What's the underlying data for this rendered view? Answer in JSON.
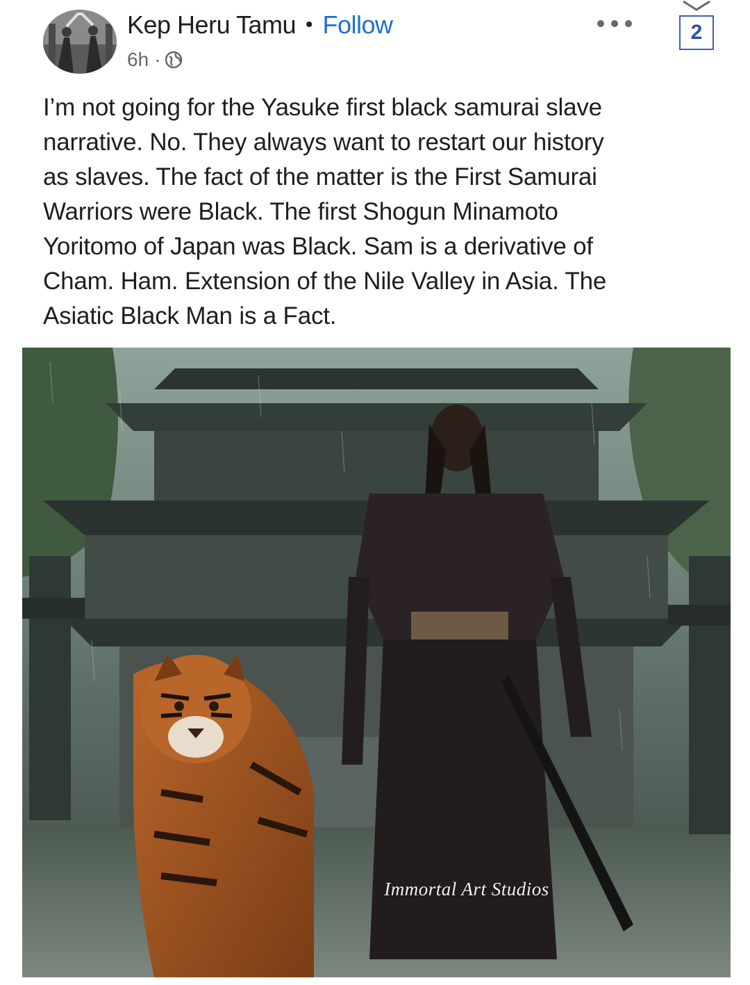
{
  "post": {
    "author": "Kep Heru Tamu",
    "separator": "•",
    "follow_label": "Follow",
    "time": "6h",
    "meta_separator": "·",
    "audience_icon": "globe-icon",
    "more_icon": "more-options-icon",
    "page_number": "2",
    "text": "I’m not going for the Yasuke first black samurai slave\nnarrative. No.  They always want to restart our history\nas slaves. The fact of the matter is the First Samurai\nWarriors were Black.  The first Shogun  Minamoto\nYoritomo of Japan was Black. Sam is  a derivative of\nCham. Ham.   Extension of the Nile Valley in Asia.  The\nAsiatic Black Man is a Fact.",
    "image": {
      "watermark": "Immortal Art Studios"
    }
  },
  "colors": {
    "link": "#1e6fd6",
    "text": "#1c1e21",
    "meta": "#65676b",
    "badge_border": "#3b5fb5"
  }
}
